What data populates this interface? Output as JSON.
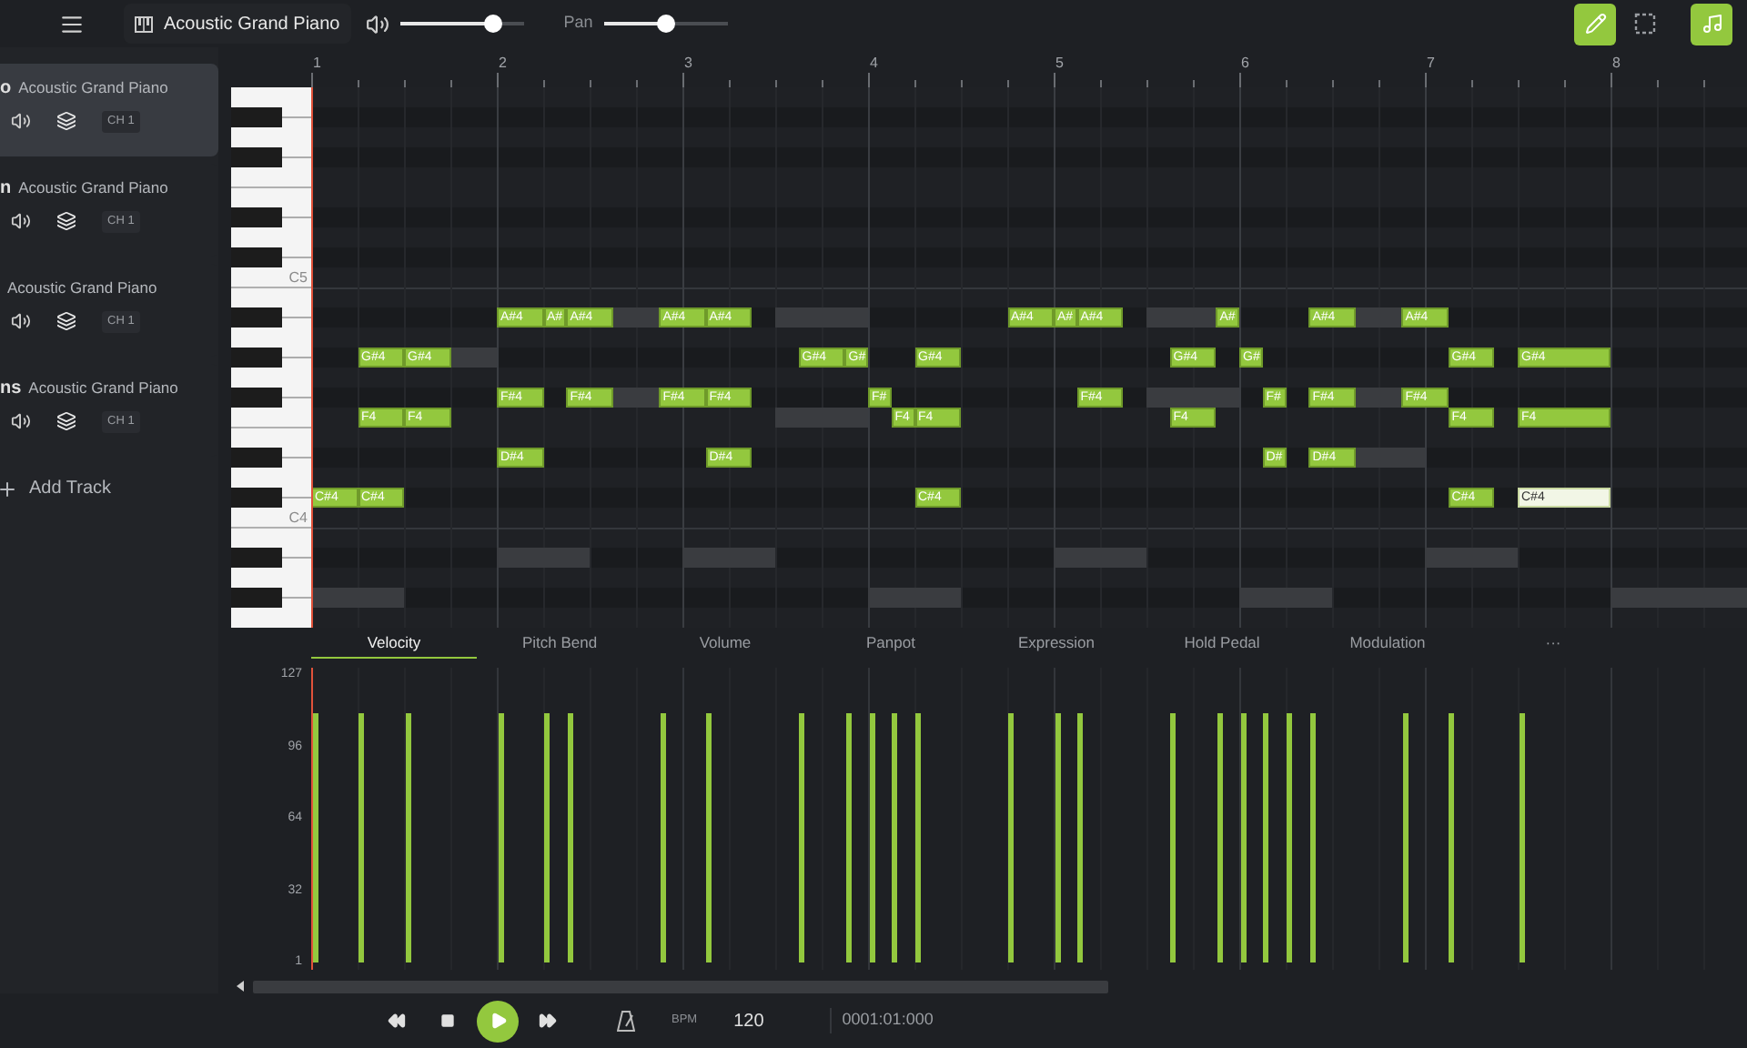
{
  "toolbar": {
    "instrument": "Acoustic Grand Piano",
    "volume": {
      "level": 0.75
    },
    "pan": {
      "label": "Pan",
      "level": 0.5
    },
    "tools": [
      {
        "kind": "pencil",
        "selected": true
      },
      {
        "kind": "select",
        "selected": false
      },
      {
        "kind": "note",
        "selected": true
      }
    ]
  },
  "tracks": [
    {
      "title": "o",
      "instrument": "Acoustic Grand Piano",
      "channel": "CH 1",
      "selected": true
    },
    {
      "title": "n",
      "instrument": "Acoustic Grand Piano",
      "channel": "CH 1",
      "selected": false
    },
    {
      "instrument": "Acoustic Grand Piano",
      "channel": "CH 1",
      "selected": false
    },
    {
      "title": "ns",
      "instrument": "Acoustic Grand Piano",
      "channel": "CH 1",
      "selected": false
    }
  ],
  "add_track": "Add Track",
  "ruler": {
    "bars": [
      "1",
      "2",
      "3",
      "4",
      "5",
      "6",
      "7",
      "8"
    ]
  },
  "roll_rows": [
    {
      "kind": "white"
    },
    {
      "kind": "black"
    },
    {
      "kind": "white"
    },
    {
      "kind": "black"
    },
    {
      "kind": "white"
    },
    {
      "kind": "white"
    },
    {
      "kind": "black"
    },
    {
      "kind": "white"
    },
    {
      "kind": "black"
    },
    {
      "kind": "white",
      "label": "C5"
    },
    {
      "kind": "white"
    },
    {
      "kind": "black",
      "notes": [
        {
          "kind": "note",
          "label": "A#4",
          "selected": false
        },
        {
          "kind": "note",
          "label": "A#",
          "selected": false
        },
        {
          "kind": "note",
          "label": "A#4",
          "selected": false
        },
        {
          "kind": "ghost"
        },
        {
          "kind": "note",
          "label": "A#4",
          "selected": false
        },
        {
          "kind": "note",
          "label": "A#4",
          "selected": false
        },
        {
          "kind": "ghost"
        },
        {
          "kind": "note",
          "label": "A#4",
          "selected": false
        },
        {
          "kind": "note",
          "label": "A#",
          "selected": false
        },
        {
          "kind": "note",
          "label": "A#4",
          "selected": false
        },
        {
          "kind": "ghost"
        },
        {
          "kind": "note",
          "label": "A#",
          "selected": false
        },
        {
          "kind": "note",
          "label": "A#4",
          "selected": false
        },
        {
          "kind": "ghost"
        },
        {
          "kind": "note",
          "label": "A#4",
          "selected": false
        }
      ]
    },
    {
      "kind": "white"
    },
    {
      "kind": "black",
      "notes": [
        {
          "kind": "note",
          "label": "G#4",
          "selected": false
        },
        {
          "kind": "note",
          "label": "G#4",
          "selected": false
        },
        {
          "kind": "ghost"
        },
        {
          "kind": "note",
          "label": "G#4",
          "selected": false
        },
        {
          "kind": "note",
          "label": "G#",
          "selected": false
        },
        {
          "kind": "note",
          "label": "G#4",
          "selected": false
        },
        {
          "kind": "note",
          "label": "G#4",
          "selected": false
        },
        {
          "kind": "note",
          "label": "G#",
          "selected": false
        },
        {
          "kind": "note",
          "label": "G#4",
          "selected": false
        },
        {
          "kind": "note",
          "label": "G#4",
          "selected": false
        }
      ]
    },
    {
      "kind": "white"
    },
    {
      "kind": "black",
      "notes": [
        {
          "kind": "note",
          "label": "F#4",
          "selected": false
        },
        {
          "kind": "note",
          "label": "F#4",
          "selected": false
        },
        {
          "kind": "ghost"
        },
        {
          "kind": "note",
          "label": "F#4",
          "selected": false
        },
        {
          "kind": "note",
          "label": "F#4",
          "selected": false
        },
        {
          "kind": "note",
          "label": "F#",
          "selected": false
        },
        {
          "kind": "note",
          "label": "F#4",
          "selected": false
        },
        {
          "kind": "ghost"
        },
        {
          "kind": "note",
          "label": "F#",
          "selected": false
        },
        {
          "kind": "note",
          "label": "F#4",
          "selected": false
        },
        {
          "kind": "ghost"
        },
        {
          "kind": "note",
          "label": "F#4",
          "selected": false
        }
      ]
    },
    {
      "kind": "white",
      "notes": [
        {
          "kind": "note",
          "label": "F4",
          "selected": false
        },
        {
          "kind": "note",
          "label": "F4",
          "selected": false
        },
        {
          "kind": "ghost"
        },
        {
          "kind": "note",
          "label": "F4",
          "selected": false
        },
        {
          "kind": "note",
          "label": "F4",
          "selected": false
        },
        {
          "kind": "note",
          "label": "F4",
          "selected": false
        },
        {
          "kind": "note",
          "label": "F4",
          "selected": false
        },
        {
          "kind": "note",
          "label": "F4",
          "selected": false
        }
      ]
    },
    {
      "kind": "white"
    },
    {
      "kind": "black",
      "notes": [
        {
          "kind": "note",
          "label": "D#4",
          "selected": false
        },
        {
          "kind": "note",
          "label": "D#4",
          "selected": false
        },
        {
          "kind": "note",
          "label": "D#",
          "selected": false
        },
        {
          "kind": "note",
          "label": "D#4",
          "selected": false
        },
        {
          "kind": "ghost"
        }
      ]
    },
    {
      "kind": "white"
    },
    {
      "kind": "black",
      "notes": [
        {
          "kind": "note",
          "label": "C#4",
          "selected": false
        },
        {
          "kind": "note",
          "label": "C#4",
          "selected": false
        },
        {
          "kind": "note",
          "label": "C#4",
          "selected": false
        },
        {
          "kind": "note",
          "label": "C#4",
          "selected": false
        },
        {
          "kind": "note",
          "label": "C#4",
          "selected": true
        }
      ]
    },
    {
      "kind": "white",
      "label": "C4"
    },
    {
      "kind": "white"
    },
    {
      "kind": "black",
      "notes": [
        {
          "kind": "ghost"
        },
        {
          "kind": "ghost"
        },
        {
          "kind": "ghost"
        },
        {
          "kind": "ghost"
        }
      ]
    },
    {
      "kind": "white"
    },
    {
      "kind": "black",
      "notes": [
        {
          "kind": "ghost"
        },
        {
          "kind": "ghost"
        },
        {
          "kind": "ghost"
        },
        {
          "kind": "ghost"
        }
      ]
    },
    {
      "kind": "white"
    }
  ],
  "lane": {
    "tabs": [
      {
        "label": "Velocity",
        "selected": true
      },
      {
        "label": "Pitch Bend",
        "selected": false
      },
      {
        "label": "Volume",
        "selected": false
      },
      {
        "label": "Panpot",
        "selected": false
      },
      {
        "label": "Expression",
        "selected": false
      },
      {
        "label": "Hold Pedal",
        "selected": false
      },
      {
        "label": "Modulation",
        "selected": false
      },
      {
        "label": "···",
        "selected": false
      }
    ],
    "axis_labels": [
      "127",
      "96",
      "64",
      "32",
      "1"
    ],
    "velocity_bars": [
      {
        "level": 0.87
      },
      {
        "level": 0.87
      },
      {
        "level": 0.87
      },
      {
        "level": 0.87
      },
      {
        "level": 0.87
      },
      {
        "level": 0.87
      },
      {
        "level": 0.87
      },
      {
        "level": 0.87
      },
      {
        "level": 0.87
      },
      {
        "level": 0.87
      },
      {
        "level": 0.87
      },
      {
        "level": 0.87
      },
      {
        "level": 0.87
      },
      {
        "level": 0.87
      },
      {
        "level": 0.87
      },
      {
        "level": 0.87
      },
      {
        "level": 0.87
      },
      {
        "level": 0.87
      },
      {
        "level": 0.87
      },
      {
        "level": 0.87
      },
      {
        "level": 0.87
      },
      {
        "level": 0.87
      },
      {
        "level": 0.87
      },
      {
        "level": 0.87
      },
      {
        "level": 0.87
      }
    ]
  },
  "transport": {
    "bpm_label": "BPM",
    "bpm": "120",
    "position": "0001:01:000"
  }
}
